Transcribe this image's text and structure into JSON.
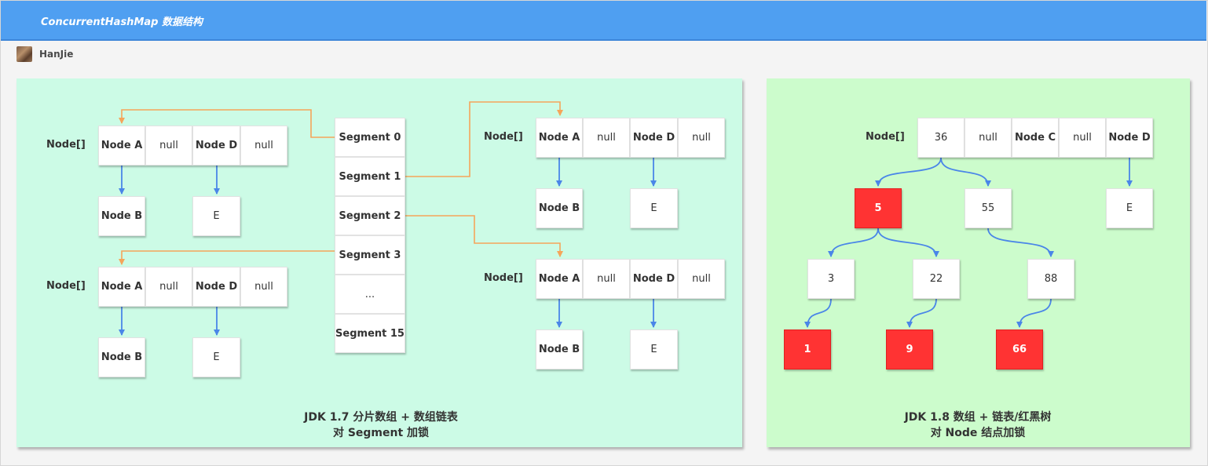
{
  "header": {
    "title": "ConcurrentHashMap 数据结构"
  },
  "author": {
    "name": "HanJie"
  },
  "colors": {
    "header": "#4f9ff1",
    "left_panel": "#ccfbe6",
    "right_panel": "#ccfccc",
    "blue_arrow": "#4a86e8",
    "orange_arrow": "#f5a55a",
    "red_node": "#ff3333"
  },
  "left": {
    "segments": [
      "Segment 0",
      "Segment 1",
      "Segment 2",
      "Segment 3",
      "...",
      "Segment 15"
    ],
    "table_label": "Node[]",
    "table_cells": [
      "Node A",
      "null",
      "Node D",
      "null"
    ],
    "chain_b": "Node B",
    "chain_e": "E",
    "caption": [
      "JDK 1.7 分片数组 + 数组链表",
      "对 Segment 加锁"
    ]
  },
  "right": {
    "table_label": "Node[]",
    "table_cells": [
      "36",
      "null",
      "Node C",
      "null",
      "Node D"
    ],
    "tree": {
      "n55": "55",
      "n5": "5",
      "n3": "3",
      "n22": "22",
      "n88": "88",
      "n1": "1",
      "n9": "9",
      "n66": "66"
    },
    "chain_e": "E",
    "caption": [
      "JDK 1.8 数组 + 链表/红黑树",
      "对 Node 结点加锁"
    ]
  }
}
